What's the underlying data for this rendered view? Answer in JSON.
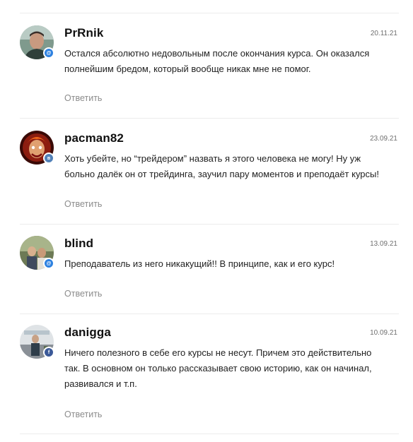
{
  "comments": [
    {
      "author": "PrRnik",
      "date": "20.11.21",
      "text": "Остался абсолютно недовольным после окончания курса. Он оказался полнейшим бредом, который вообще никак мне не помог.",
      "reply": "Ответить",
      "badge_icon": "mail-icon"
    },
    {
      "author": "pacman82",
      "date": "23.09.21",
      "text": "Хоть убейте, но “трейдером” назвать я этого человека не могу! Ну уж больно далёк он от трейдинга, заучил пару моментов и преподаёт курсы!",
      "reply": "Ответить",
      "badge_icon": "vk-icon"
    },
    {
      "author": "blind",
      "date": "13.09.21",
      "text": "Преподаватель из него никакущий!! В принципе, как и его курс!",
      "reply": "Ответить",
      "badge_icon": "mail-icon"
    },
    {
      "author": "danigga",
      "date": "10.09.21",
      "text": "Ничего полезного в себе его курсы не несут. Причем это действительно так. В основном он только рассказывает свою историю, как он начинал, развивался и т.п.",
      "reply": "Ответить",
      "badge_icon": "facebook-icon"
    }
  ],
  "colors": {
    "mail": "#2d81e0",
    "vk": "#5181b8",
    "facebook": "#3b5998",
    "divider": "#ececec"
  }
}
